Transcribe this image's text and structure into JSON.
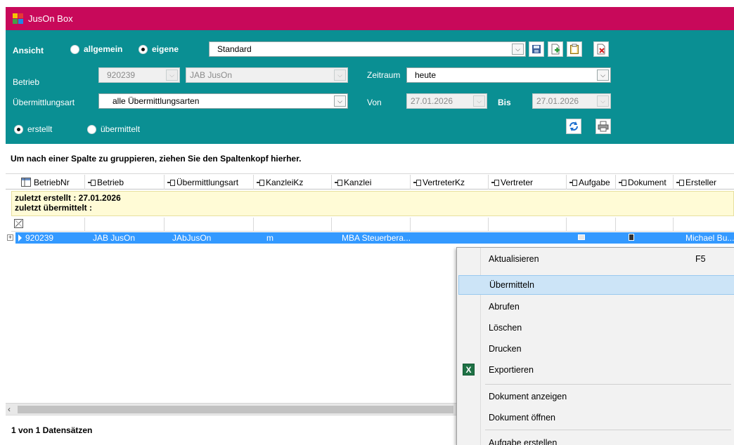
{
  "window": {
    "title": "JusOn Box"
  },
  "filter": {
    "ansicht_label": "Ansicht",
    "radio_allgemein": "allgemein",
    "radio_eigene": "eigene",
    "view_combo_value": "Standard",
    "betrieb_label": "Betrieb",
    "betrieb_nr_value": "920239",
    "betrieb_name_value": "JAB JusOn",
    "zeitraum_label": "Zeitraum",
    "zeitraum_value": "heute",
    "uebermittlungsart_label": "Übermittlungsart",
    "uebermittlungsart_value": "alle Übermittlungsarten",
    "von_label": "Von",
    "von_value": "27.01.2026",
    "bis_label": "Bis",
    "bis_value": "27.01.2026",
    "radio_erstellt": "erstellt",
    "radio_uebermittelt": "übermittelt",
    "selected_ansicht": "eigene",
    "selected_status": "erstellt"
  },
  "group_hint": "Um nach einer Spalte zu gruppieren, ziehen Sie den Spaltenkopf hierher.",
  "grid": {
    "columns": [
      "BetriebNr",
      "Betrieb",
      "Übermittlungsart",
      "KanzleiKz",
      "Kanzlei",
      "VertreterKz",
      "Vertreter",
      "Aufgabe",
      "Dokument",
      "Ersteller"
    ],
    "summary_line1": "zuletzt erstellt : 27.01.2026",
    "summary_line2": "zuletzt übermittelt :",
    "rows": [
      {
        "betriebnr": "920239",
        "betrieb": "JAB JusOn",
        "uebermittlungsart": "JAbJusOn",
        "kanzleikz": "m",
        "kanzlei": "MBA  Steuerbera...",
        "ersteller": "Michael  Bu..."
      }
    ]
  },
  "status": {
    "record_count": "1 von 1 Datensätzen"
  },
  "context_menu": {
    "items": [
      {
        "label": "Aktualisieren",
        "shortcut": "F5"
      },
      {
        "label": "Übermitteln"
      },
      {
        "label": "Abrufen"
      },
      {
        "label": "Löschen"
      },
      {
        "label": "Drucken"
      },
      {
        "label": "Exportieren",
        "icon": "excel-icon"
      },
      {
        "label": "Dokument anzeigen"
      },
      {
        "label": "Dokument öffnen"
      },
      {
        "label": "Aufgabe erstellen"
      }
    ],
    "highlighted": "Übermitteln"
  },
  "colors": {
    "titlebar": "#c8095a",
    "panel": "#0a8f93",
    "selection": "#3399ff",
    "summary_bg": "#fffbd6",
    "menu_highlight": "#cce4f7"
  }
}
